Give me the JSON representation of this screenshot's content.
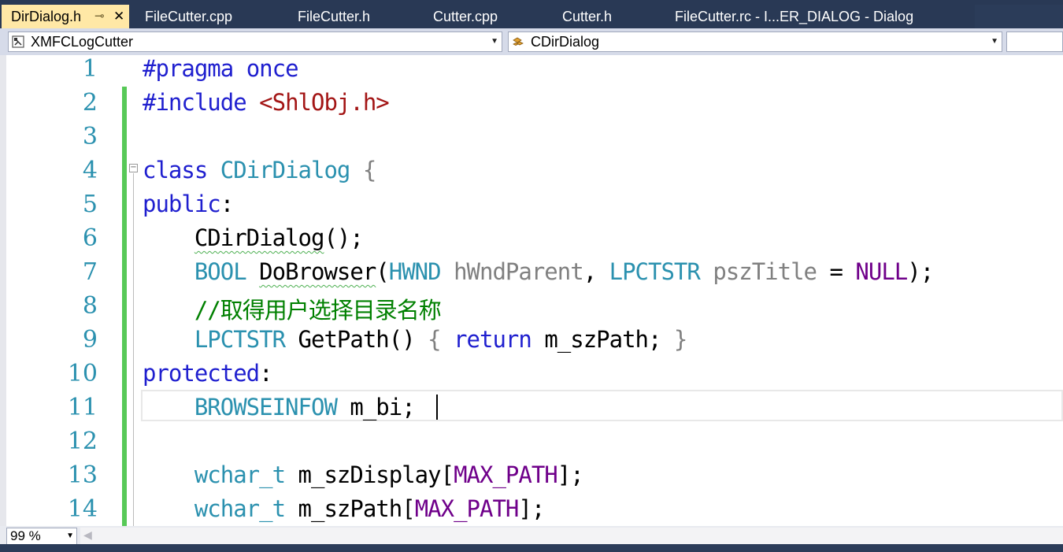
{
  "tabs": [
    {
      "label": "DirDialog.h",
      "active": true
    },
    {
      "label": "FileCutter.cpp"
    },
    {
      "label": "FileCutter.h"
    },
    {
      "label": "Cutter.cpp"
    },
    {
      "label": "Cutter.h"
    },
    {
      "label": "FileCutter.rc - I...ER_DIALOG - Dialog"
    }
  ],
  "tab_pin_glyph": "⊸",
  "tab_close_glyph": "✕",
  "nav": {
    "project": "XMFCLogCutter",
    "scope": "CDirDialog",
    "dropdown_glyph": "▼"
  },
  "code": {
    "line_numbers": [
      "1",
      "2",
      "3",
      "4",
      "5",
      "6",
      "7",
      "8",
      "9",
      "10",
      "11",
      "12",
      "13",
      "14"
    ],
    "l1": {
      "kw": "#pragma",
      "rest": "once"
    },
    "l2": {
      "kw": "#include",
      "inc": "<ShlObj.h>"
    },
    "l4": {
      "kw": "class",
      "name": "CDirDialog",
      "brace": "{"
    },
    "l5": {
      "kw": "public",
      "colon": ":"
    },
    "l6": {
      "fn": "CDirDialog",
      "rest": "();"
    },
    "l7": {
      "t1": "BOOL",
      "fn": "DoBrowser",
      "p1": "(",
      "t2": "HWND",
      "a1": "hWndParent",
      "c1": ",",
      "t3": "LPCTSTR",
      "a2": "pszTitle",
      "eq": "=",
      "nul": "NULL",
      "end": ");"
    },
    "l8": {
      "comment": "//取得用户选择目录名称"
    },
    "l9": {
      "t": "LPCTSTR",
      "fn": "GetPath",
      "p": "()",
      "b1": "{",
      "kw": "return",
      "rest": "m_szPath;",
      "b2": "}"
    },
    "l10": {
      "kw": "protected",
      "colon": ":"
    },
    "l11": {
      "t": "BROWSEINFOW",
      "rest": "m_bi;"
    },
    "l13": {
      "t": "wchar_t",
      "name": "m_szDisplay",
      "lb": "[",
      "mac": "MAX_PATH",
      "rb": "];"
    },
    "l14": {
      "t": "wchar_t",
      "name": "m_szPath",
      "lb": "[",
      "mac": "MAX_PATH",
      "rb": "];"
    },
    "fold_glyph": "−"
  },
  "status": {
    "zoom": "99 %",
    "scroll_left_glyph": "◀"
  },
  "colors": {
    "keyword": "#1f1fcf",
    "type": "#2b91af",
    "macro": "#6f008a",
    "string": "#a31515",
    "comment": "#008000",
    "tabbar": "#293955",
    "active_tab": "#ffe8a6"
  }
}
